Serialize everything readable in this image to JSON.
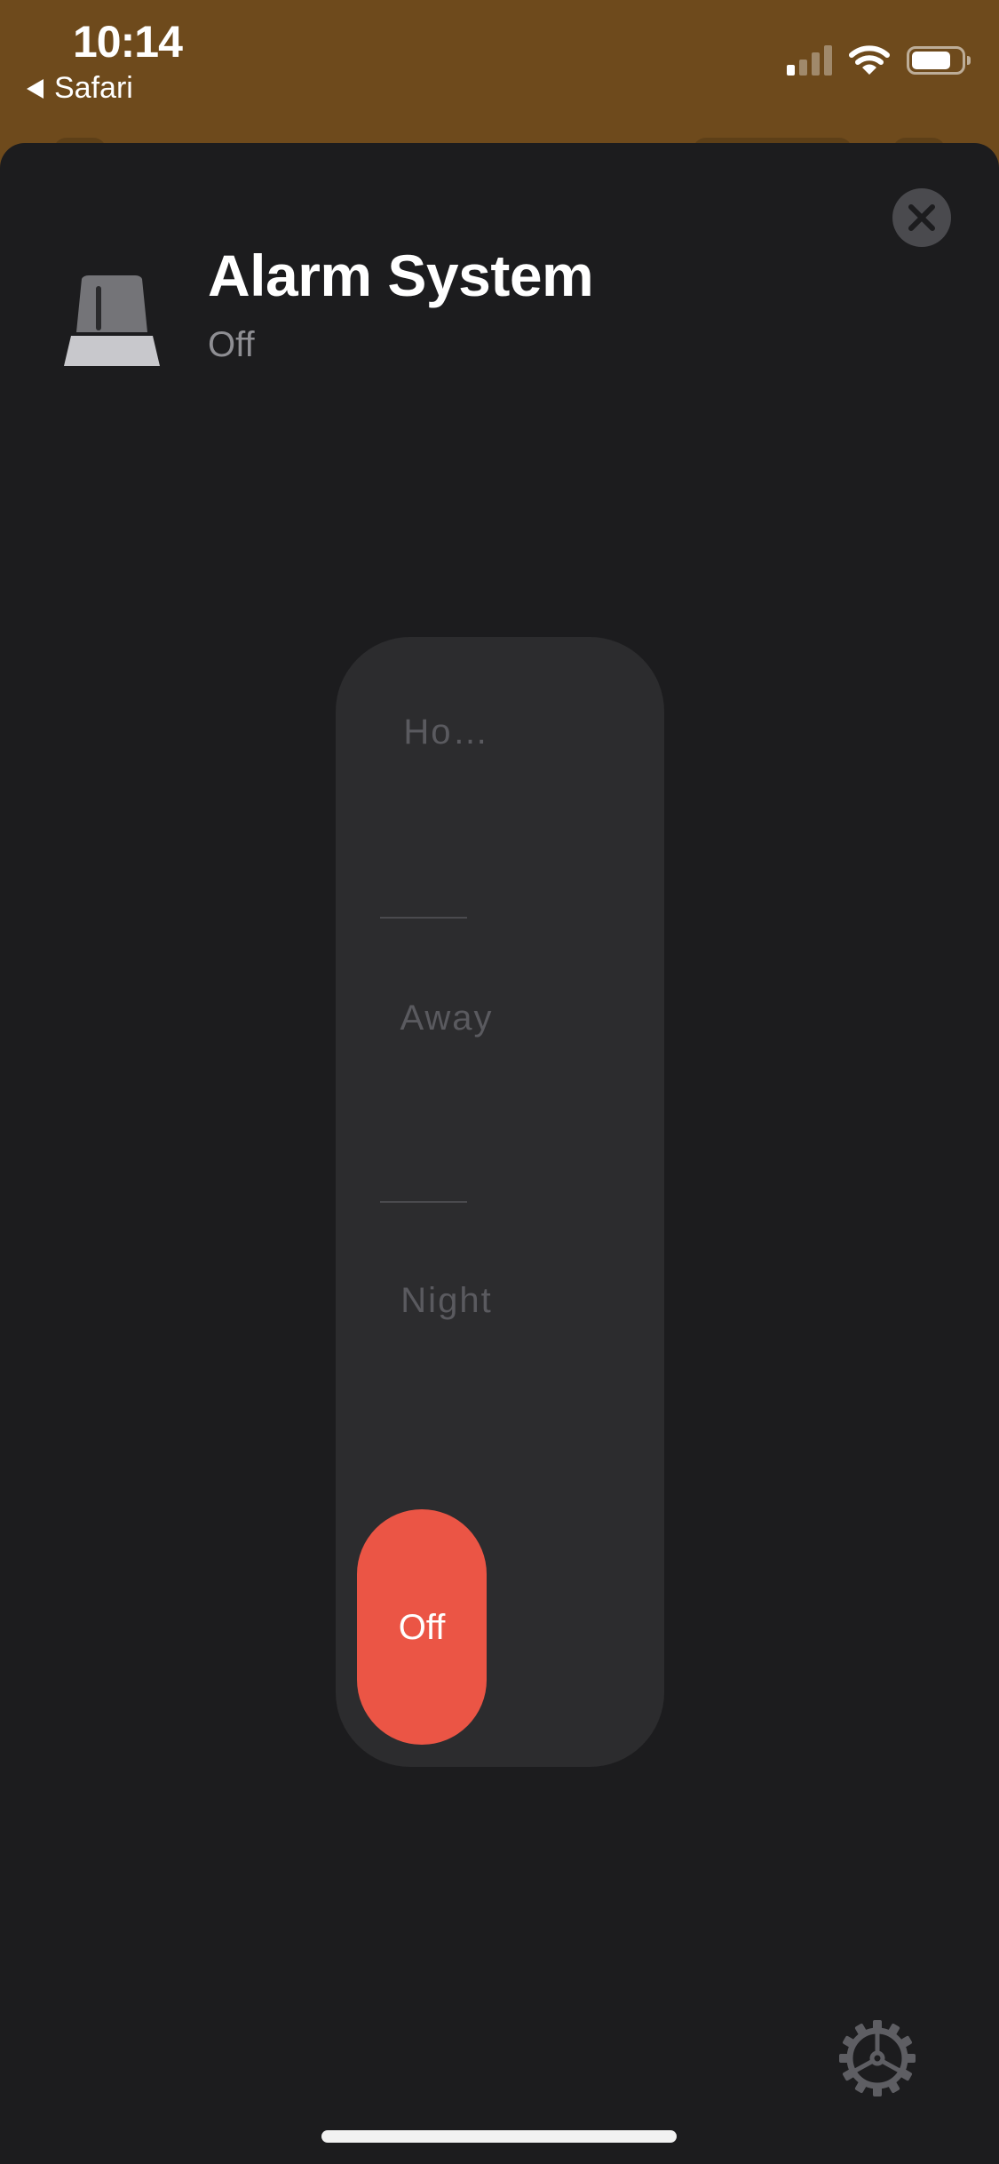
{
  "status_bar": {
    "time": "10:14",
    "back_app": "Safari",
    "icons": [
      "cellular-signal-icon",
      "wifi-icon",
      "battery-icon"
    ]
  },
  "sheet": {
    "title": "Alarm System",
    "state": "Off",
    "device_icon": "security-system-icon",
    "close_icon": "close-icon",
    "settings_icon": "gear-icon"
  },
  "selector": {
    "options": [
      {
        "label": "Ho…"
      },
      {
        "label": "Away"
      },
      {
        "label": "Night"
      }
    ],
    "selected": {
      "label": "Off"
    }
  },
  "colors": {
    "accent": "#eb5545",
    "sheet_background": "#1c1c1e",
    "selector_background": "#2c2c2e",
    "wallpaper": "#6e4a1c"
  }
}
